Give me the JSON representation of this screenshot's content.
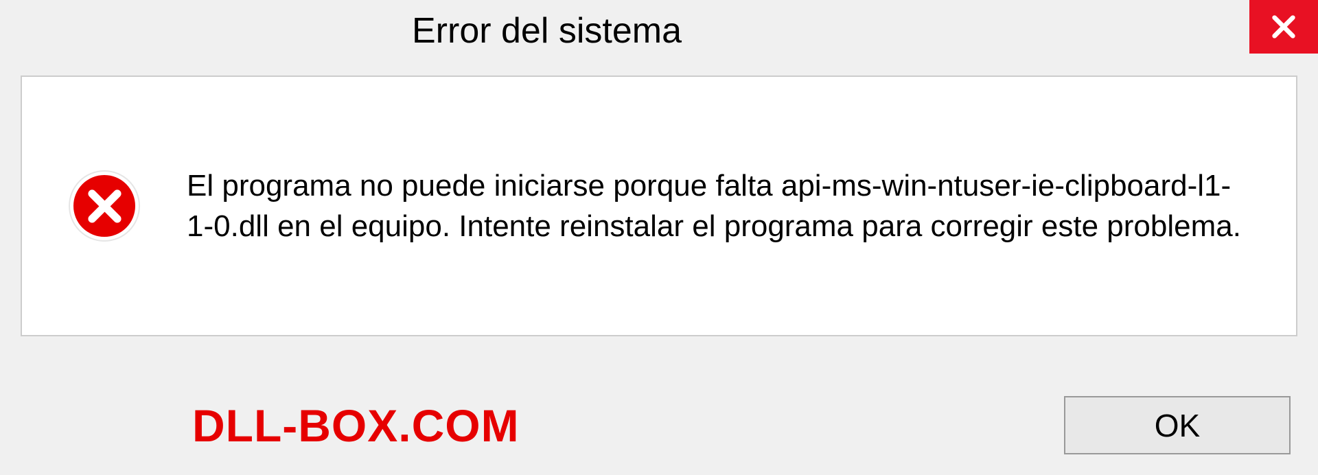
{
  "titlebar": {
    "title": "Error del sistema"
  },
  "dialog": {
    "message": "El programa no puede iniciarse porque falta api-ms-win-ntuser-ie-clipboard-l1-1-0.dll en el equipo. Intente reinstalar el programa para corregir este problema."
  },
  "footer": {
    "watermark": "DLL-BOX.COM",
    "ok_label": "OK"
  },
  "colors": {
    "close_bg": "#e81123",
    "error_icon_bg": "#e60000",
    "watermark_color": "#e60000"
  }
}
